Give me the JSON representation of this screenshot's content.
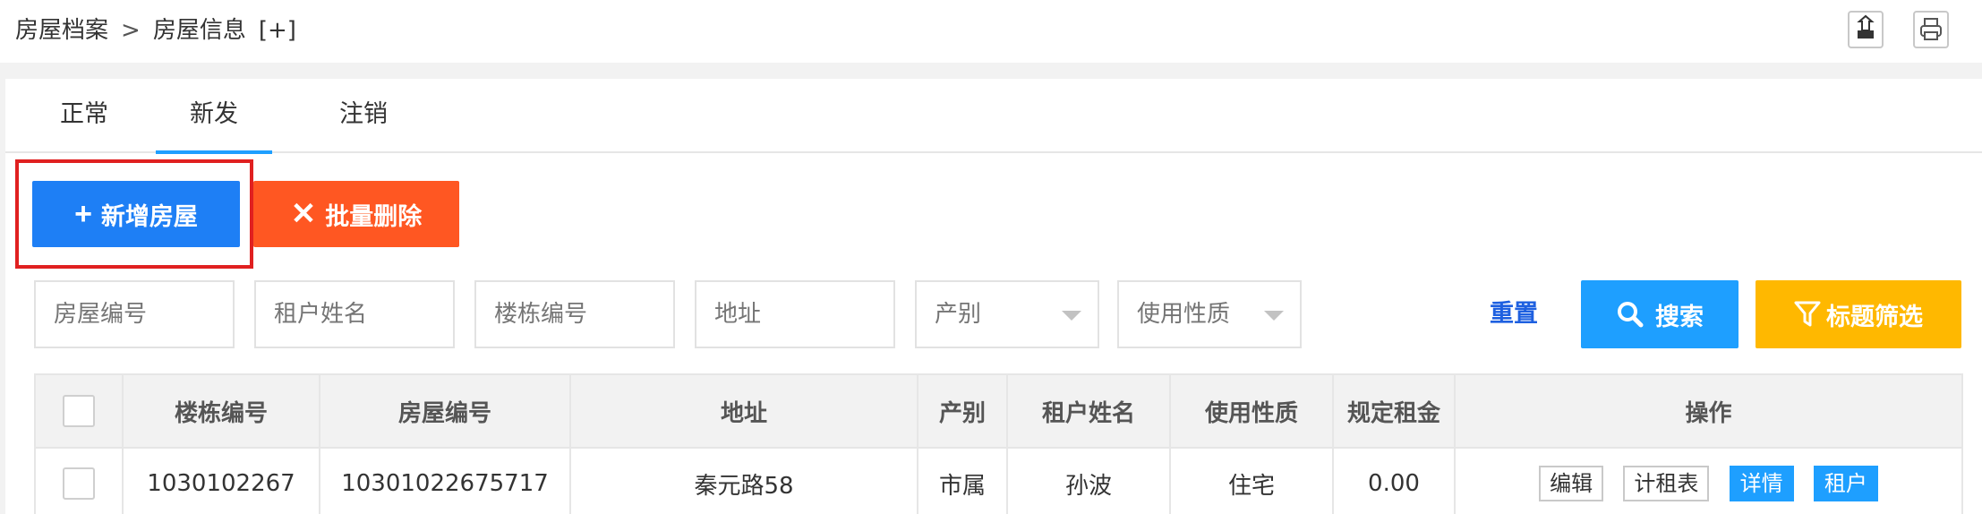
{
  "breadcrumb": {
    "parent": "房屋档案",
    "separator": ">",
    "current": "房屋信息",
    "toggle": "[+]"
  },
  "toolbar": {
    "icons": [
      "export-icon",
      "print-icon"
    ]
  },
  "tabs": [
    {
      "label": "正常",
      "active": false
    },
    {
      "label": "新发",
      "active": true
    },
    {
      "label": "注销",
      "active": false
    }
  ],
  "actions": {
    "add_icon": "+",
    "add_label": "新增房屋",
    "delete_icon": "✕",
    "delete_label": "批量删除"
  },
  "filters": {
    "house_no_placeholder": "房屋编号",
    "tenant_placeholder": "租户姓名",
    "building_placeholder": "楼栋编号",
    "address_placeholder": "地址",
    "ownership_select": "产别",
    "usage_select": "使用性质",
    "reset_label": "重置",
    "search_label": "搜索",
    "filter_label": "标题筛选"
  },
  "table": {
    "headers": [
      "楼栋编号",
      "房屋编号",
      "地址",
      "产别",
      "租户姓名",
      "使用性质",
      "规定租金",
      "操作"
    ],
    "rows": [
      {
        "building_no": "1030102267",
        "house_no": "10301022675717",
        "address": "秦元路58",
        "ownership": "市属",
        "tenant": "孙波",
        "usage": "住宅",
        "rent": "0.00",
        "ops": [
          "编辑",
          "计租表",
          "详情",
          "租户"
        ]
      }
    ]
  },
  "colors": {
    "primary": "#1e7ff5",
    "danger": "#ff5722",
    "info": "#1e9fff",
    "warn": "#ffb800",
    "highlight": "#e02020"
  }
}
